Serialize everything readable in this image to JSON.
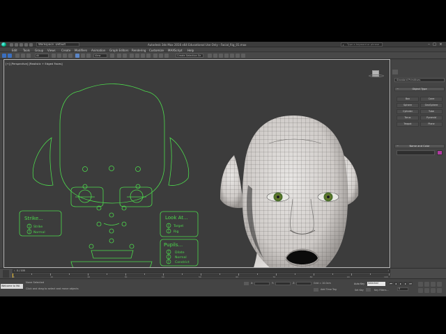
{
  "titlebar": {
    "workspace": "Workspace: Default",
    "title": "Autodesk 3ds Max 2016 x64   Educational Use Only - Facial_Rig_01.max",
    "search_placeholder": "Type a keyword or phrase"
  },
  "menubar": {
    "items": [
      "Edit",
      "Tools",
      "Group",
      "Views",
      "Create",
      "Modifiers",
      "Animation",
      "Graph Editors",
      "Rendering",
      "Customize",
      "MAXScript",
      "Help"
    ]
  },
  "toolbar": {
    "selection_filter": "All",
    "ref_coord": "View",
    "named_selection": "Create Selection Se"
  },
  "viewport": {
    "label": "[+] [Perspective] [Realistic + Edged Faces]"
  },
  "rig_ui": {
    "strike_title": "Strike...",
    "strike_options": [
      "Strike",
      "Normal"
    ],
    "lookat_title": "Look At...",
    "lookat_options": [
      "Target",
      "Rig"
    ],
    "pupils_title": "Pupils...",
    "pupils_options": [
      "Dilate",
      "Normal",
      "Constrict"
    ]
  },
  "command_panel": {
    "category": "Standard Primitives",
    "object_type_title": "Object Type",
    "object_buttons": [
      "Box",
      "Cone",
      "Sphere",
      "GeoSphere",
      "Cylinder",
      "Tube",
      "Torus",
      "Pyramid",
      "Teapot",
      "Plane"
    ],
    "name_color_title": "Name and Color"
  },
  "timeline": {
    "frame_label": "0 / 100",
    "ruler_numbers": [
      "0",
      "10",
      "20",
      "30",
      "40",
      "50",
      "60",
      "70",
      "80",
      "90",
      "100"
    ]
  },
  "statusbar": {
    "maxscript_label": "Welcome to MA",
    "status_line": "None Selected",
    "prompt_line": "Click and drag to select and move objects",
    "x_label": "X:",
    "y_label": "Y:",
    "z_label": "Z:",
    "grid_label": "Grid = 10.0cm",
    "add_time_tag": "Add Time Tag",
    "auto_key": "Auto Key",
    "set_key": "Set Key",
    "selected": "Selected",
    "key_filters": "Key Filters...",
    "current_frame": "0"
  },
  "colors": {
    "rig_green": "#4ddb4d",
    "viewport_bg": "#3c3c3c",
    "panel_bg": "#444444",
    "swatch": "#b23aa2"
  }
}
